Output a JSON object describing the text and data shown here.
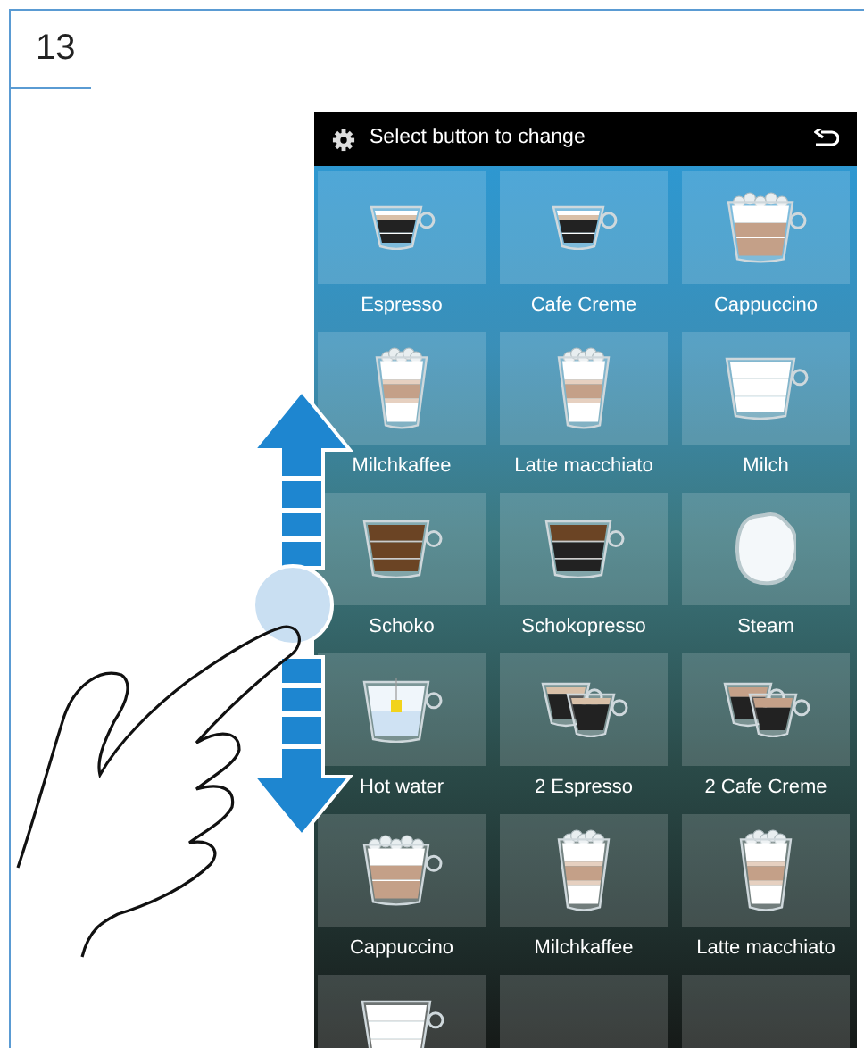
{
  "step_number": "13",
  "screen": {
    "header": {
      "title": "Select button to change"
    },
    "drinks": [
      {
        "label": "Espresso",
        "kind": "espresso"
      },
      {
        "label": "Cafe Creme",
        "kind": "espresso"
      },
      {
        "label": "Cappuccino",
        "kind": "cappuccino"
      },
      {
        "label": "Milchkaffee",
        "kind": "glass"
      },
      {
        "label": "Latte macchiato",
        "kind": "glass"
      },
      {
        "label": "Milch",
        "kind": "milk"
      },
      {
        "label": "Schoko",
        "kind": "schoko"
      },
      {
        "label": "Schokopresso",
        "kind": "schokopresso"
      },
      {
        "label": "Steam",
        "kind": "steam"
      },
      {
        "label": "Hot water",
        "kind": "tea"
      },
      {
        "label": "2 Espresso",
        "kind": "double"
      },
      {
        "label": "2 Cafe Creme",
        "kind": "double-creme"
      },
      {
        "label": "Cappuccino",
        "kind": "cappuccino"
      },
      {
        "label": "Milchkaffee",
        "kind": "glass"
      },
      {
        "label": "Latte macchiato",
        "kind": "glass"
      },
      {
        "kind": "milk"
      },
      {
        "kind": "blank"
      },
      {
        "kind": "blank"
      }
    ]
  }
}
